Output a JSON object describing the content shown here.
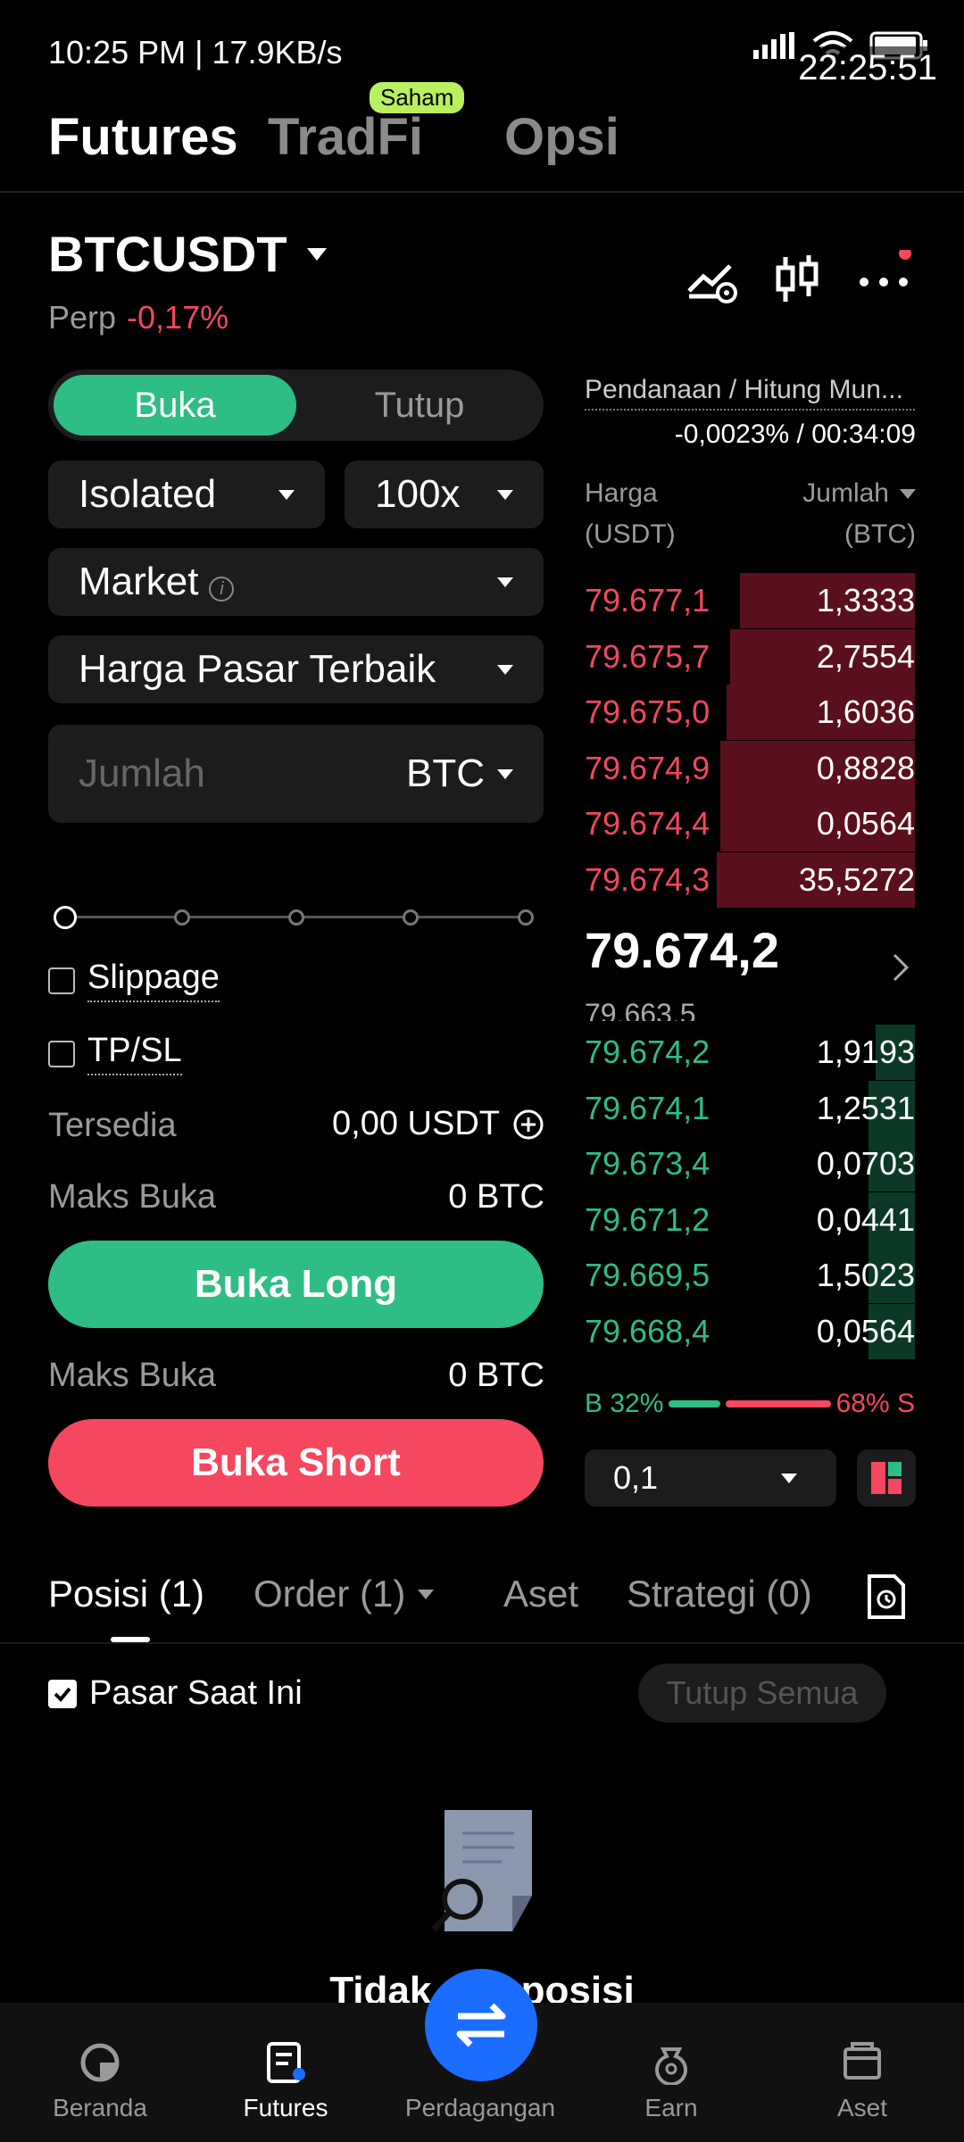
{
  "status_bar": {
    "time_speed": "10:25 PM | 17.9KB/s",
    "battery": "90",
    "clock": "22:25:51"
  },
  "top_tabs": {
    "futures": "Futures",
    "tradfi": "TradFi",
    "tradfi_badge": "Saham",
    "opsi": "Opsi"
  },
  "symbol": {
    "name": "BTCUSDT",
    "type": "Perp",
    "change": "-0,17%"
  },
  "form": {
    "open_label": "Buka",
    "close_label": "Tutup",
    "margin_mode": "Isolated",
    "leverage": "100x",
    "order_type": "Market",
    "price_mode": "Harga Pasar Terbaik",
    "amount_placeholder": "Jumlah",
    "amount_unit": "BTC",
    "slippage_label": "Slippage",
    "tpsl_label": "TP/SL",
    "available_label": "Tersedia",
    "available_value": "0,00 USDT",
    "max_open_label": "Maks Buka",
    "max_open_long_value": "0 BTC",
    "long_button": "Buka Long",
    "max_open_short_value": "0 BTC",
    "short_button": "Buka Short"
  },
  "orderbook": {
    "funding_label": "Pendanaan / Hitung Mun...",
    "funding_value": "-0,0023% / 00:34:09",
    "price_header": "Harga",
    "price_unit": "(USDT)",
    "qty_header": "Jumlah",
    "qty_unit": "(BTC)",
    "asks": [
      {
        "price": "79.677,1",
        "qty": "1,3333",
        "depth": 0.53
      },
      {
        "price": "79.675,7",
        "qty": "2,7554",
        "depth": 0.56
      },
      {
        "price": "79.675,0",
        "qty": "1,6036",
        "depth": 0.57
      },
      {
        "price": "79.674,9",
        "qty": "0,8828",
        "depth": 0.59
      },
      {
        "price": "79.674,4",
        "qty": "0,0564",
        "depth": 0.59
      },
      {
        "price": "79.674,3",
        "qty": "35,5272",
        "depth": 0.6
      }
    ],
    "last_price": "79.674,2",
    "mark_price": "79.663,5",
    "bids": [
      {
        "price": "79.674,2",
        "qty": "1,9193",
        "depth": 0.12
      },
      {
        "price": "79.674,1",
        "qty": "1,2531",
        "depth": 0.14
      },
      {
        "price": "79.673,4",
        "qty": "0,0703",
        "depth": 0.14
      },
      {
        "price": "79.671,2",
        "qty": "0,0441",
        "depth": 0.14
      },
      {
        "price": "79.669,5",
        "qty": "1,5023",
        "depth": 0.14
      },
      {
        "price": "79.668,4",
        "qty": "0,0564",
        "depth": 0.14
      }
    ],
    "buy_ratio": "B 32%",
    "sell_ratio": "68% S",
    "buy_pct": 32,
    "tick_size": "0,1"
  },
  "positions": {
    "tabs": [
      "Posisi (1)",
      "Order (1)",
      "Aset",
      "Strategi (0)"
    ],
    "current_market": "Pasar Saat Ini",
    "close_all": "Tutup Semua",
    "empty_text": "Tidak ada posisi"
  },
  "bottom_nav": [
    "Beranda",
    "Futures",
    "Perdagangan",
    "Earn",
    "Aset"
  ],
  "colors": {
    "green": "#2ebd85",
    "red": "#f5475d",
    "blue": "#1a6dff",
    "badge": "#b8f060"
  }
}
